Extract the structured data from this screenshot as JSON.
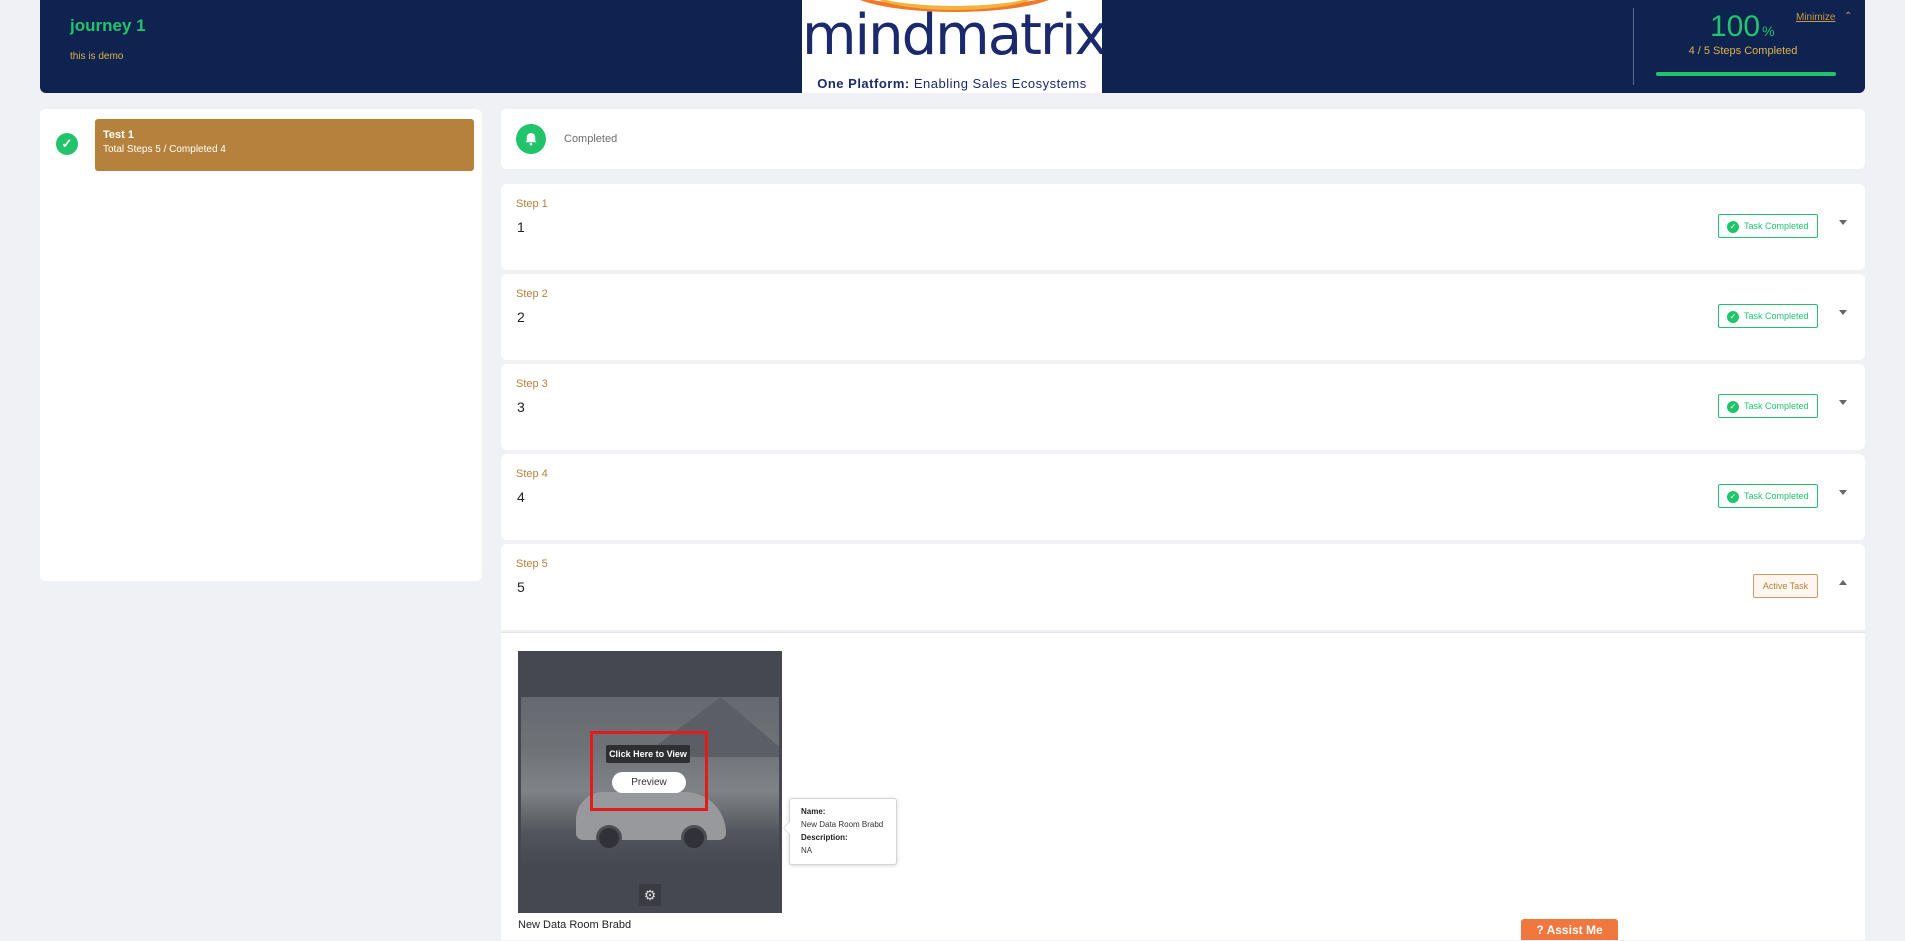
{
  "header": {
    "journey_title": "journey 1",
    "journey_subtitle": "this is demo",
    "logo_text": "mindmatrix",
    "logo_tag_bold": "One Platform:",
    "logo_tag_rest": " Enabling Sales Ecosystems",
    "percent": "100",
    "percent_sign": "%",
    "steps_completed": "4 / 5 Steps Completed",
    "progress_fraction": 1.0,
    "minimize_label": "Minimize",
    "minimize_icon": "chevron-up-icon"
  },
  "sidebar": {
    "test": {
      "name": "Test 1",
      "summary": "Total Steps 5 / Completed 4",
      "status_icon": "check-icon"
    }
  },
  "status": {
    "icon": "bell-icon",
    "label": "Completed"
  },
  "steps": [
    {
      "label": "Step 1",
      "number": "1",
      "badge": "Task Completed",
      "state": "completed",
      "expanded": false
    },
    {
      "label": "Step 2",
      "number": "2",
      "badge": "Task Completed",
      "state": "completed",
      "expanded": false
    },
    {
      "label": "Step 3",
      "number": "3",
      "badge": "Task Completed",
      "state": "completed",
      "expanded": false
    },
    {
      "label": "Step 4",
      "number": "4",
      "badge": "Task Completed",
      "state": "completed",
      "expanded": false
    },
    {
      "label": "Step 5",
      "number": "5",
      "badge": "Active Task",
      "state": "active",
      "expanded": true
    }
  ],
  "asset": {
    "click_hint": "Click Here to View",
    "preview_label": "Preview",
    "settings_icon": "gear-icon",
    "name": "New Data Room Brabd",
    "info": {
      "name_label": "Name:",
      "name_value": "New Data Room Brabd",
      "description_label": "Description:",
      "description_value": "NA"
    }
  },
  "assist": {
    "icon": "question-icon",
    "icon_glyph": "?",
    "label": "Assist Me"
  },
  "colors": {
    "header_bg": "#0f2350",
    "green": "#22c46b",
    "gold": "#b5823d",
    "assist": "#f0783e"
  }
}
